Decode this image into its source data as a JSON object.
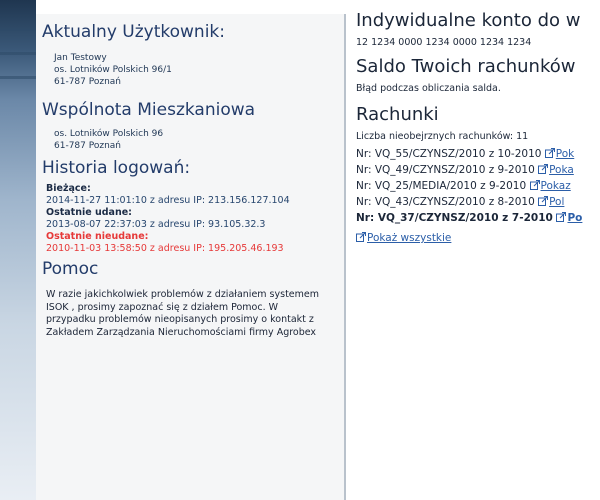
{
  "user": {
    "title": "Aktualny Użytkownik:",
    "name": "Jan Testowy",
    "street": "os. Lotników Polskich 96/1",
    "city": "61-787 Poznań"
  },
  "community": {
    "title": "Wspólnota Mieszkaniowa",
    "street": "os. Lotników Polskich 96",
    "city": "61-787 Poznań"
  },
  "login_history": {
    "title": "Historia logowań:",
    "current_label": "Bieżące:",
    "current_value": "2014-11-27 11:01:10 z adresu IP: 213.156.127.104",
    "last_ok_label": "Ostatnie udane:",
    "last_ok_value": "2013-08-07 22:37:03 z adresu IP: 93.105.32.3",
    "last_fail_label": "Ostatnie nieudane:",
    "last_fail_value": "2010-11-03 13:58:50 z adresu IP: 195.205.46.193"
  },
  "help": {
    "title": "Pomoc",
    "line1": "W razie jakichkolwiek problemów z działaniem systemem",
    "line2": "ISOK , prosimy zapoznać się z działem Pomoc. W",
    "line3": "przypadku problemów nieopisanych prosimy o kontakt z",
    "line4": "Zakładem Zarządzania Nieruchomościami firmy Agrobex"
  },
  "account": {
    "title": "Indywidualne konto do w",
    "number": "12 1234 0000 1234 0000 1234 1234"
  },
  "balance": {
    "title": "Saldo Twoich rachunków",
    "message": "Błąd podczas obliczania salda."
  },
  "bills": {
    "title": "Rachunki",
    "unpaid_label": "Liczba nieobejrznych rachunków: 11",
    "items": [
      {
        "text": "Nr: VQ_55/CZYNSZ/2010 z 10-2010",
        "link": "Pok"
      },
      {
        "text": "Nr: VQ_49/CZYNSZ/2010 z 9-2010",
        "link": "Poka"
      },
      {
        "text": "Nr: VQ_25/MEDIA/2010 z 9-2010",
        "link": "Pokaz"
      },
      {
        "text": "Nr: VQ_43/CZYNSZ/2010 z 8-2010",
        "link": "Pol"
      },
      {
        "text": "Nr: VQ_37/CZYNSZ/2010 z 7-2010",
        "link": "Po"
      }
    ],
    "show_all": "Pokaż wszystkie"
  },
  "colors": {
    "heading": "#233c6a",
    "fail": "#e63939",
    "link": "#2b5ea8"
  }
}
